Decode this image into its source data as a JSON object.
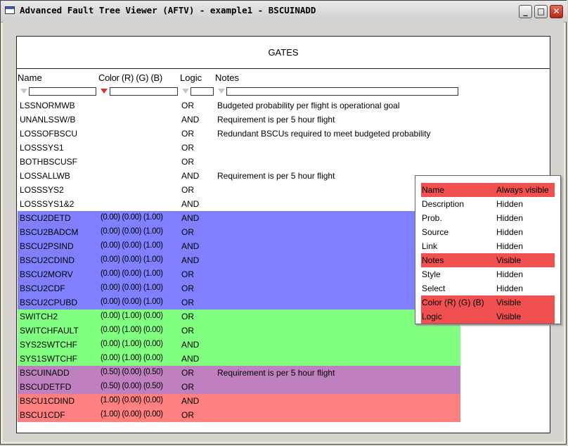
{
  "window": {
    "title": "Advanced Fault Tree Viewer (AFTV) - example1 - BSCUINADD",
    "minimize": "_",
    "maximize": "□",
    "close": "✕"
  },
  "panel": {
    "title": "GATES",
    "columns": {
      "name": "Name",
      "color": "Color (R) (G) (B)",
      "logic": "Logic",
      "notes": "Notes"
    }
  },
  "colors": {
    "blue": "#8080ff",
    "green": "#80ff80",
    "purple": "#bf80bf",
    "red": "#ff8080",
    "visible_highlight": "#f05050",
    "active_filter": "#e03030"
  },
  "rows": [
    {
      "name": "LSSNORMWB",
      "color": "",
      "logic": "OR",
      "notes": "Budgeted probability per flight is operational goal",
      "bg": ""
    },
    {
      "name": "UNANLSSW/B",
      "color": "",
      "logic": "AND",
      "notes": "Requirement is per 5 hour flight",
      "bg": ""
    },
    {
      "name": "LOSSOFBSCU",
      "color": "",
      "logic": "OR",
      "notes": "Redundant BSCUs required to meet budgeted probability",
      "bg": ""
    },
    {
      "name": "LOSSSYS1",
      "color": "",
      "logic": "OR",
      "notes": "",
      "bg": ""
    },
    {
      "name": "BOTHBSCUSF",
      "color": "",
      "logic": "OR",
      "notes": "",
      "bg": ""
    },
    {
      "name": "LOSSALLWB",
      "color": "",
      "logic": "AND",
      "notes": "Requirement is per 5 hour flight",
      "bg": ""
    },
    {
      "name": "LOSSSYS2",
      "color": "",
      "logic": "OR",
      "notes": "",
      "bg": ""
    },
    {
      "name": "LOSSSYS1&2",
      "color": "",
      "logic": "AND",
      "notes": "",
      "bg": ""
    },
    {
      "name": "BSCU2DETD",
      "color": "(0.00) (0.00) (1.00)",
      "logic": "AND",
      "notes": "",
      "bg": "#8080ff"
    },
    {
      "name": "BSCU2BADCM",
      "color": "(0.00) (0.00) (1.00)",
      "logic": "OR",
      "notes": "",
      "bg": "#8080ff"
    },
    {
      "name": "BSCU2PSIND",
      "color": "(0.00) (0.00) (1.00)",
      "logic": "AND",
      "notes": "",
      "bg": "#8080ff"
    },
    {
      "name": "BSCU2CDIND",
      "color": "(0.00) (0.00) (1.00)",
      "logic": "AND",
      "notes": "",
      "bg": "#8080ff"
    },
    {
      "name": "BSCU2MORV",
      "color": "(0.00) (0.00) (1.00)",
      "logic": "OR",
      "notes": "",
      "bg": "#8080ff"
    },
    {
      "name": "BSCU2CDF",
      "color": "(0.00) (0.00) (1.00)",
      "logic": "OR",
      "notes": "",
      "bg": "#8080ff"
    },
    {
      "name": "BSCU2CPUBD",
      "color": "(0.00) (0.00) (1.00)",
      "logic": "OR",
      "notes": "",
      "bg": "#8080ff"
    },
    {
      "name": "SWITCH2",
      "color": "(0.00) (1.00) (0.00)",
      "logic": "OR",
      "notes": "",
      "bg": "#80ff80"
    },
    {
      "name": "SWITCHFAULT",
      "color": "(0.00) (1.00) (0.00)",
      "logic": "OR",
      "notes": "",
      "bg": "#80ff80"
    },
    {
      "name": "SYS2SWTCHF",
      "color": "(0.00) (1.00) (0.00)",
      "logic": "AND",
      "notes": "",
      "bg": "#80ff80"
    },
    {
      "name": "SYS1SWTCHF",
      "color": "(0.00) (1.00) (0.00)",
      "logic": "AND",
      "notes": "",
      "bg": "#80ff80"
    },
    {
      "name": "BSCUINADD",
      "color": "(0.50) (0.00) (0.50)",
      "logic": "OR",
      "notes": "Requirement is per 5 hour flight",
      "bg": "#bf80bf"
    },
    {
      "name": "BSCUDETFD",
      "color": "(0.50) (0.00) (0.50)",
      "logic": "OR",
      "notes": "",
      "bg": "#bf80bf"
    },
    {
      "name": "BSCU1CDIND",
      "color": "(1.00) (0.00) (0.00)",
      "logic": "AND",
      "notes": "",
      "bg": "#ff8080"
    },
    {
      "name": "BSCU1CDF",
      "color": "(1.00) (0.00) (0.00)",
      "logic": "OR",
      "notes": "",
      "bg": "#ff8080"
    }
  ],
  "column_popup": [
    {
      "label": "Name",
      "state": "Always visible",
      "highlight": true
    },
    {
      "label": "Description",
      "state": "Hidden",
      "highlight": false
    },
    {
      "label": "Prob.",
      "state": "Hidden",
      "highlight": false
    },
    {
      "label": "Source",
      "state": "Hidden",
      "highlight": false
    },
    {
      "label": "Link",
      "state": "Hidden",
      "highlight": false
    },
    {
      "label": "Notes",
      "state": "Visible",
      "highlight": true
    },
    {
      "label": "Style",
      "state": "Hidden",
      "highlight": false
    },
    {
      "label": "Select",
      "state": "Hidden",
      "highlight": false
    },
    {
      "label": "Color (R) (G) (B)",
      "state": "Visible",
      "highlight": true
    },
    {
      "label": "Logic",
      "state": "Visible",
      "highlight": true
    }
  ]
}
